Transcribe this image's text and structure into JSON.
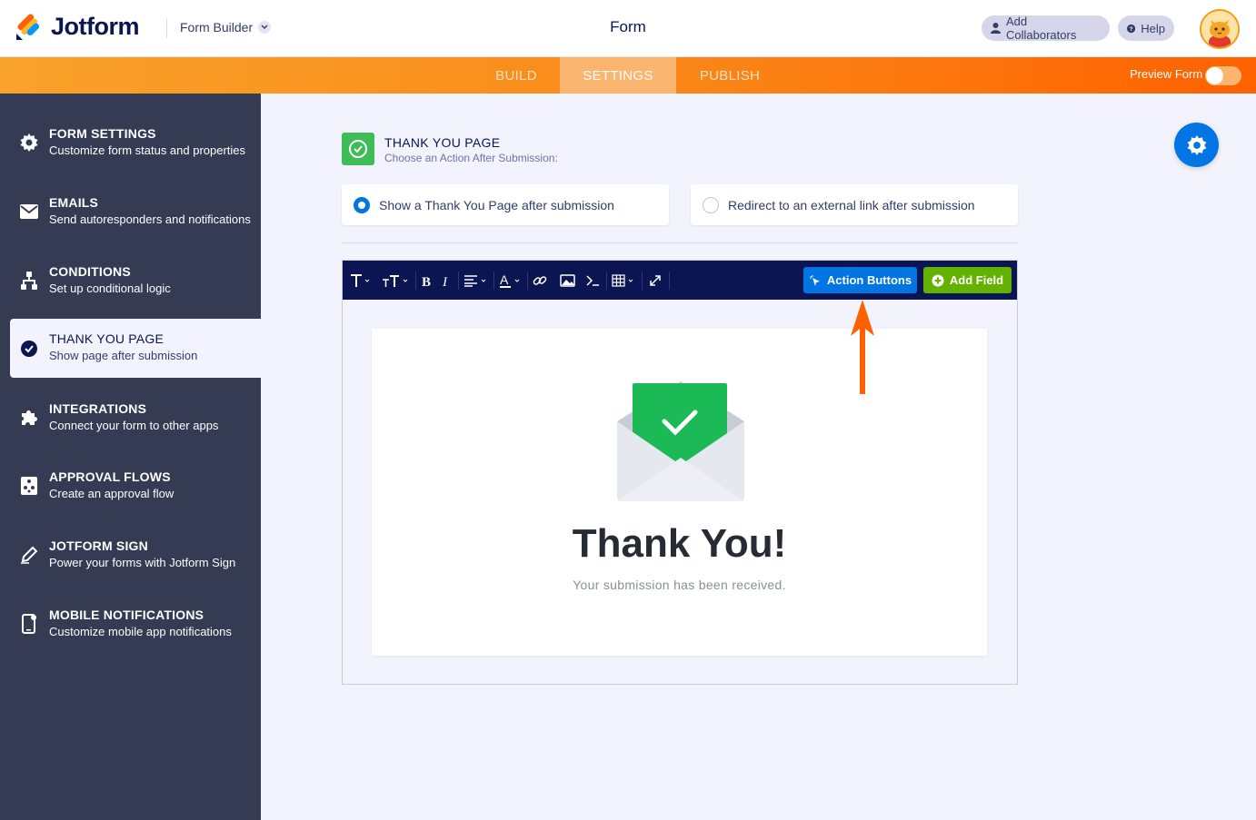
{
  "header": {
    "logo_text": "Jotform",
    "product_menu": "Form Builder",
    "title": "Form",
    "add_collaborators": "Add Collaborators",
    "help": "Help"
  },
  "nav": {
    "tabs": [
      "BUILD",
      "SETTINGS",
      "PUBLISH"
    ],
    "active_tab": "SETTINGS",
    "preview_label": "Preview Form",
    "preview_on": false
  },
  "sidebar": {
    "items": [
      {
        "title": "FORM SETTINGS",
        "subtitle": "Customize form status and properties",
        "icon": "gear-icon"
      },
      {
        "title": "EMAILS",
        "subtitle": "Send autoresponders and notifications",
        "icon": "envelope-icon"
      },
      {
        "title": "CONDITIONS",
        "subtitle": "Set up conditional logic",
        "icon": "sitemap-icon"
      },
      {
        "title": "THANK YOU PAGE",
        "subtitle": "Show page after submission",
        "icon": "check-circle-icon"
      },
      {
        "title": "INTEGRATIONS",
        "subtitle": "Connect your form to other apps",
        "icon": "puzzle-icon"
      },
      {
        "title": "APPROVAL FLOWS",
        "subtitle": "Create an approval flow",
        "icon": "approval-icon"
      },
      {
        "title": "JOTFORM SIGN",
        "subtitle": "Power your forms with Jotform Sign",
        "icon": "pen-icon"
      },
      {
        "title": "MOBILE NOTIFICATIONS",
        "subtitle": "Customize mobile app notifications",
        "icon": "mobile-icon"
      }
    ],
    "active_index": 3
  },
  "main": {
    "section_title": "THANK YOU PAGE",
    "section_subtitle": "Choose an Action After Submission:",
    "options": [
      {
        "label": "Show a Thank You Page after submission",
        "checked": true
      },
      {
        "label": "Redirect to an external link after submission",
        "checked": false
      }
    ],
    "editor": {
      "action_buttons": "Action Buttons",
      "add_field": "Add Field",
      "heading": "Thank You!",
      "message": "Your submission has been received."
    }
  },
  "colors": {
    "brand_blue": "#0075e3",
    "navy": "#0a1551",
    "sidebar_bg": "#343b52",
    "green": "#64b200",
    "success_green": "#1bba57",
    "orange_arrow": "#ff6100"
  }
}
